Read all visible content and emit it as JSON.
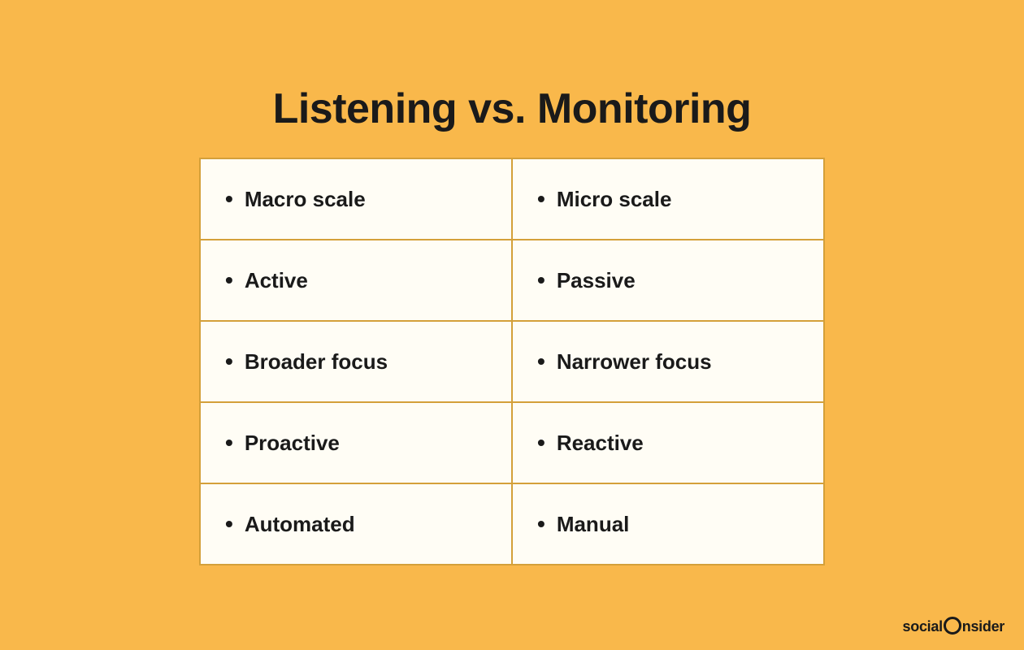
{
  "page": {
    "background_color": "#F9B84B",
    "title": "Listening vs. Monitoring"
  },
  "table": {
    "rows": [
      {
        "left": "Macro scale",
        "right": "Micro scale"
      },
      {
        "left": "Active",
        "right": "Passive"
      },
      {
        "left": "Broader focus",
        "right": "Narrower focus"
      },
      {
        "left": "Proactive",
        "right": "Reactive"
      },
      {
        "left": "Automated",
        "right": "Manual"
      }
    ]
  },
  "brand": {
    "name_before_dot": "social",
    "name_after_dot": "nsider"
  }
}
